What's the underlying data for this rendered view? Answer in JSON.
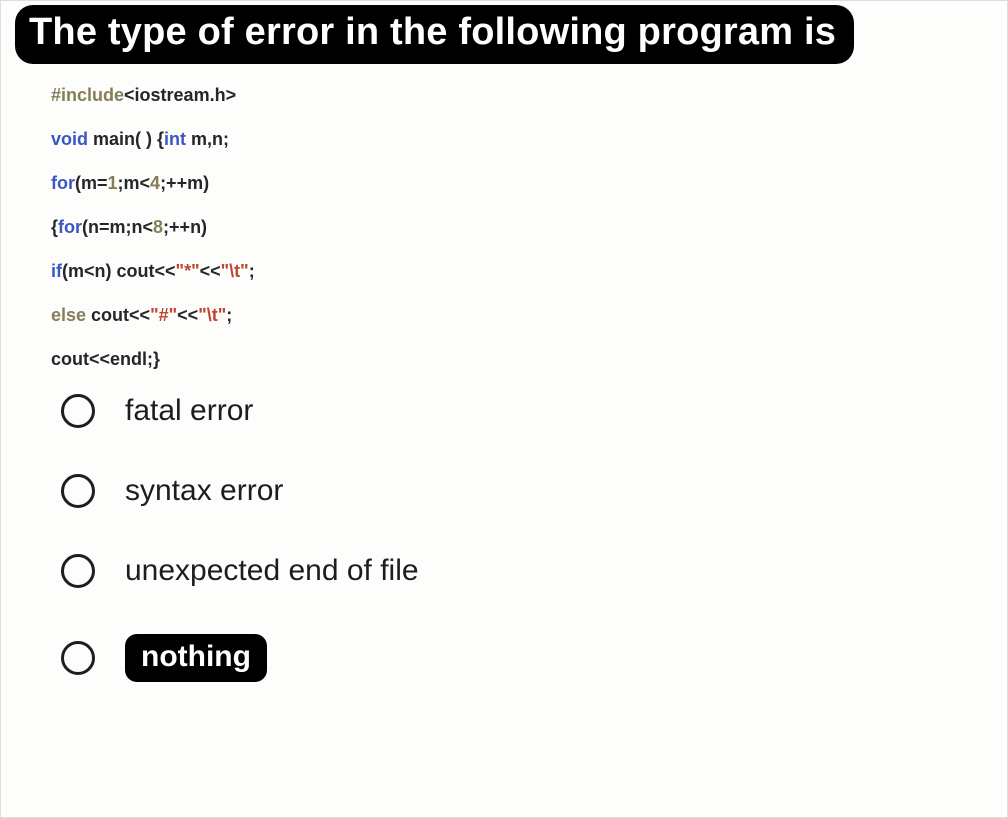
{
  "title": "The type of error in the following program is",
  "code": {
    "l1": {
      "a": "#include",
      "b": "<iostream.h>"
    },
    "l2": {
      "a": "void",
      "b": " main( ) {",
      "c": "int",
      "d": " m,n;"
    },
    "l3": {
      "a": "for",
      "b": "(m=",
      "c": "1",
      "d": ";m<",
      "e": "4",
      "f": ";++m)"
    },
    "l4": {
      "a": "{",
      "b": "for",
      "c": "(n=m;n<",
      "d": "8",
      "e": ";++n)"
    },
    "l5": {
      "a": "if",
      "b": "(m<n) cout<<",
      "c": "\"*\"",
      "d": "<<",
      "e": "\"\\t\"",
      "f": ";"
    },
    "l6": {
      "a": "else",
      "b": " cout<<",
      "c": "\"#\"",
      "d": "<<",
      "e": "\"\\t\"",
      "f": ";"
    },
    "l7": {
      "a": "cout<<endl;}"
    }
  },
  "options": [
    {
      "label": "fatal error",
      "highlighted": false
    },
    {
      "label": "syntax error",
      "highlighted": false
    },
    {
      "label": "unexpected end of file",
      "highlighted": false
    },
    {
      "label": "nothing",
      "highlighted": true
    }
  ]
}
